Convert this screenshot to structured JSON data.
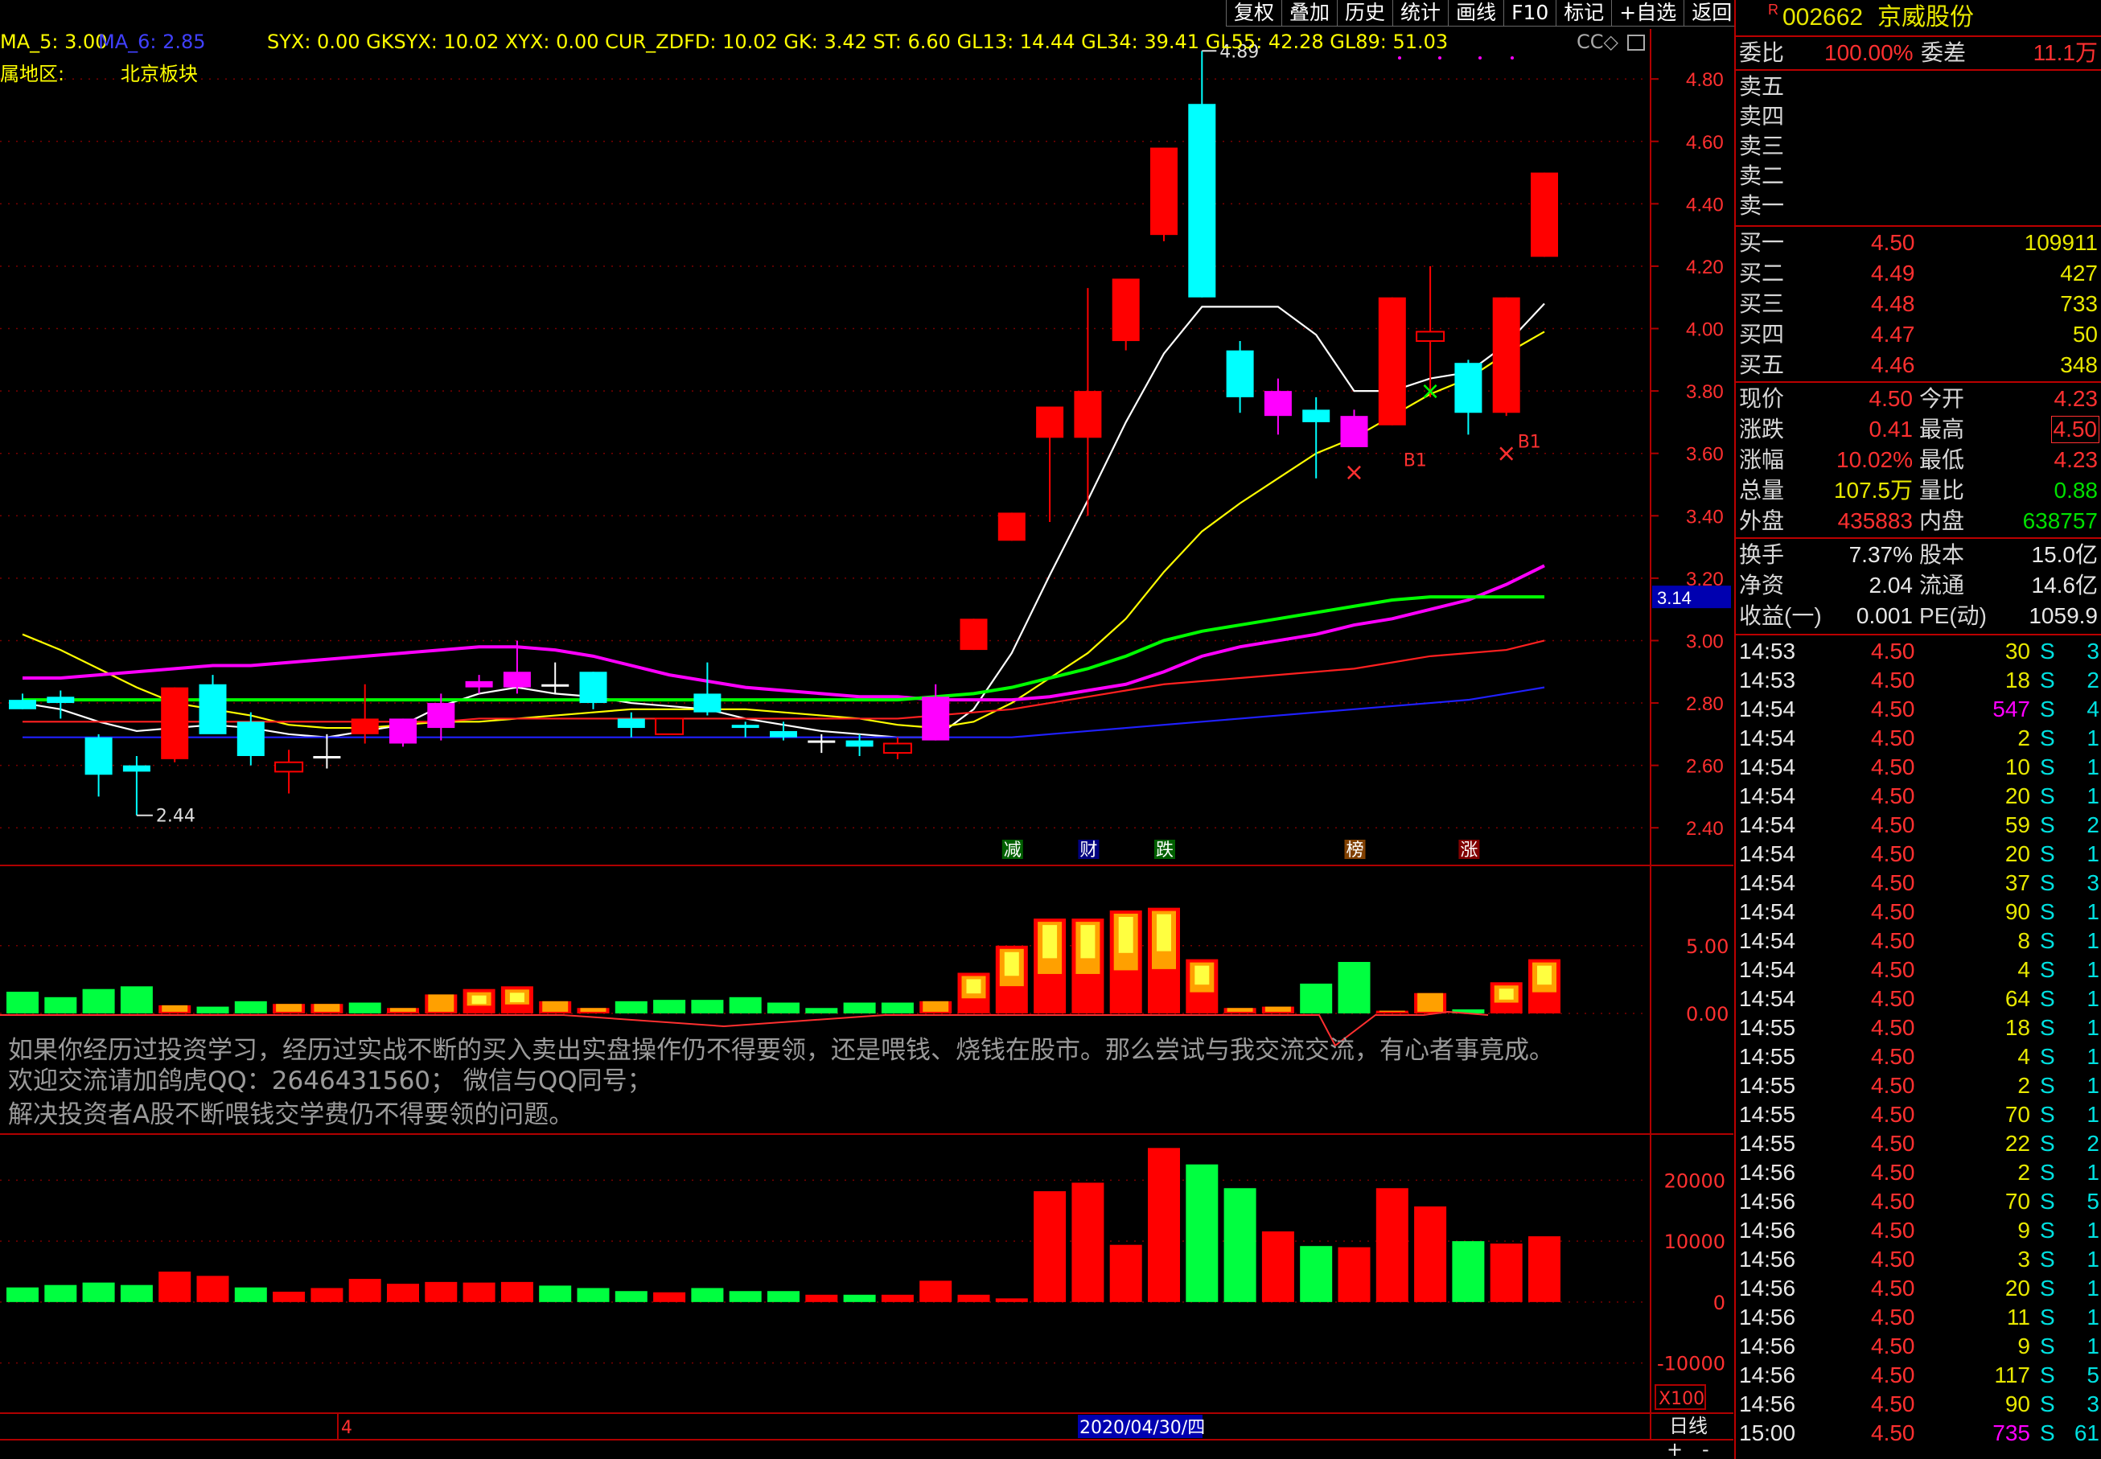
{
  "toolbar": [
    "复权",
    "叠加",
    "历史",
    "统计",
    "画线",
    "F10",
    "标记",
    "+自选",
    "返回"
  ],
  "top_legend": {
    "ma5": "MA_5: 3.00",
    "ma6": "MA_6: 2.85",
    "indicators": "SYX: 0.00  GKSYX: 10.02  XYX: 0.00  CUR_ZDFD: 10.02  GK: 3.42  ST: 6.60  GL13: 14.44  GL34: 39.41  GL55: 42.28  GL89: 51.03",
    "right_marks": "CC◇"
  },
  "region": {
    "label": "属地区:",
    "value": "北京板块"
  },
  "price_labels": {
    "high": "4.89",
    "low": "2.44",
    "current_tag": "3.14"
  },
  "event_tags": [
    "减",
    "财",
    "跌",
    "榜",
    "涨"
  ],
  "signals": {
    "b1a": "B1",
    "b1b": "B1",
    "x_red": "×",
    "x_green": "×"
  },
  "overlay_text": [
    "如果你经历过投资学习，经历过实战不断的买入卖出实盘操作仍不得要领，还是喂钱、烧钱在股市。那么尝试与我交流交流，有心者事竟成。",
    "欢迎交流请加鸽虎QQ：2646431560； 微信与QQ同号；",
    "解决投资者A股不断喂钱交学费仍不得要领的问题。"
  ],
  "x100": "X100",
  "date_bar": {
    "month_tick": "4",
    "date": "2020/04/30/四",
    "period": "日线",
    "plus": "+",
    "minus": "-"
  },
  "chart_data": [
    {
      "type": "candlestick",
      "title": "",
      "ylim": [
        2.3,
        4.95
      ],
      "yticks": [
        2.4,
        2.6,
        2.8,
        3.0,
        3.2,
        3.4,
        3.6,
        3.8,
        4.0,
        4.2,
        4.4,
        4.6,
        4.8
      ],
      "candles": [
        {
          "o": 2.81,
          "h": 2.83,
          "l": 2.78,
          "c": 2.78
        },
        {
          "o": 2.82,
          "h": 2.84,
          "l": 2.75,
          "c": 2.8
        },
        {
          "o": 2.57,
          "h": 2.7,
          "l": 2.5,
          "c": 2.69
        },
        {
          "o": 2.6,
          "h": 2.63,
          "l": 2.44,
          "c": 2.58
        },
        {
          "o": 2.62,
          "h": 2.85,
          "l": 2.61,
          "c": 2.85
        },
        {
          "o": 2.86,
          "h": 2.89,
          "l": 2.71,
          "c": 2.7
        },
        {
          "o": 2.63,
          "h": 2.77,
          "l": 2.6,
          "c": 2.74
        },
        {
          "o": 2.61,
          "h": 2.65,
          "l": 2.51,
          "c": 2.58
        },
        {
          "o": 2.63,
          "h": 2.7,
          "l": 2.59,
          "c": 2.63
        },
        {
          "o": 2.7,
          "h": 2.86,
          "l": 2.67,
          "c": 2.75
        },
        {
          "o": 2.67,
          "h": 2.75,
          "l": 2.66,
          "c": 2.75
        },
        {
          "o": 2.8,
          "h": 2.83,
          "l": 2.68,
          "c": 2.72
        },
        {
          "o": 2.85,
          "h": 2.89,
          "l": 2.83,
          "c": 2.87
        },
        {
          "o": 2.85,
          "h": 3.0,
          "l": 2.83,
          "c": 2.9
        },
        {
          "o": 2.86,
          "h": 2.93,
          "l": 2.83,
          "c": 2.86
        },
        {
          "o": 2.9,
          "h": 2.9,
          "l": 2.78,
          "c": 2.8
        },
        {
          "o": 2.75,
          "h": 2.77,
          "l": 2.69,
          "c": 2.72
        },
        {
          "o": 2.7,
          "h": 2.75,
          "l": 2.7,
          "c": 2.75
        },
        {
          "o": 2.83,
          "h": 2.93,
          "l": 2.76,
          "c": 2.77
        },
        {
          "o": 2.73,
          "h": 2.74,
          "l": 2.69,
          "c": 2.72
        },
        {
          "o": 2.71,
          "h": 2.74,
          "l": 2.68,
          "c": 2.69
        },
        {
          "o": 2.68,
          "h": 2.7,
          "l": 2.64,
          "c": 2.68
        },
        {
          "o": 2.68,
          "h": 2.7,
          "l": 2.63,
          "c": 2.66
        },
        {
          "o": 2.64,
          "h": 2.69,
          "l": 2.62,
          "c": 2.67
        },
        {
          "o": 2.82,
          "h": 2.86,
          "l": 2.68,
          "c": 2.68
        },
        {
          "o": 2.97,
          "h": 3.07,
          "l": 2.97,
          "c": 3.07
        },
        {
          "o": 3.32,
          "h": 3.41,
          "l": 3.32,
          "c": 3.41
        },
        {
          "o": 3.65,
          "h": 3.75,
          "l": 3.38,
          "c": 3.75
        },
        {
          "o": 3.65,
          "h": 4.13,
          "l": 3.4,
          "c": 3.8
        },
        {
          "o": 3.96,
          "h": 4.16,
          "l": 3.93,
          "c": 4.16
        },
        {
          "o": 4.3,
          "h": 4.58,
          "l": 4.28,
          "c": 4.58
        },
        {
          "o": 4.72,
          "h": 4.89,
          "l": 4.1,
          "c": 4.1
        },
        {
          "o": 3.93,
          "h": 3.96,
          "l": 3.73,
          "c": 3.78
        },
        {
          "o": 3.8,
          "h": 3.84,
          "l": 3.66,
          "c": 3.72
        },
        {
          "o": 3.74,
          "h": 3.78,
          "l": 3.52,
          "c": 3.7
        },
        {
          "o": 3.72,
          "h": 3.74,
          "l": 3.62,
          "c": 3.62
        },
        {
          "o": 3.69,
          "h": 4.1,
          "l": 3.69,
          "c": 4.1
        },
        {
          "o": 3.96,
          "h": 4.2,
          "l": 3.78,
          "c": 3.99
        },
        {
          "o": 3.89,
          "h": 3.9,
          "l": 3.66,
          "c": 3.73
        },
        {
          "o": 3.73,
          "h": 4.1,
          "l": 3.72,
          "c": 4.1
        },
        {
          "o": 4.23,
          "h": 4.5,
          "l": 4.23,
          "c": 4.5
        }
      ],
      "candle_colors": [
        "#00ffff",
        "#00ffff",
        "#00ffff",
        "#00ffff",
        "#ff0000",
        "#00ffff",
        "#00ffff",
        "#ff0000",
        "#ffffff",
        "#ff0000",
        "#ff00ff",
        "#ff00ff",
        "#ff00ff",
        "#ff00ff",
        "#ffffff",
        "#00ffff",
        "#00ffff",
        "#ff0000",
        "#00ffff",
        "#00ffff",
        "#00ffff",
        "#ffffff",
        "#00ffff",
        "#ff0000",
        "#ff00ff",
        "#ff0000",
        "#ff0000",
        "#ff0000",
        "#ff0000",
        "#ff0000",
        "#ff0000",
        "#00ffff",
        "#00ffff",
        "#ff00ff",
        "#00ffff",
        "#ff00ff",
        "#ff0000",
        "#ff0000",
        "#00ffff",
        "#ff0000",
        "#ff0000"
      ],
      "candle_hollow": [
        false,
        false,
        false,
        false,
        false,
        false,
        false,
        true,
        false,
        false,
        false,
        false,
        false,
        false,
        false,
        false,
        false,
        true,
        false,
        false,
        false,
        false,
        false,
        true,
        false,
        false,
        false,
        false,
        false,
        false,
        false,
        false,
        false,
        false,
        false,
        false,
        false,
        true,
        false,
        false,
        false
      ],
      "ma_lines": [
        {
          "color": "#ffffff",
          "values": [
            2.8,
            2.78,
            2.74,
            2.71,
            2.72,
            2.73,
            2.72,
            2.7,
            2.69,
            2.71,
            2.73,
            2.79,
            2.83,
            2.85,
            2.83,
            2.82,
            2.8,
            2.79,
            2.78,
            2.75,
            2.73,
            2.71,
            2.7,
            2.69,
            2.69,
            2.78,
            2.96,
            3.21,
            3.45,
            3.7,
            3.92,
            4.07,
            4.07,
            4.07,
            3.98,
            3.8,
            3.8,
            3.84,
            3.86,
            3.95,
            4.08
          ]
        },
        {
          "color": "#ffff00",
          "values": [
            3.02,
            2.97,
            2.91,
            2.85,
            2.8,
            2.78,
            2.76,
            2.73,
            2.72,
            2.72,
            2.73,
            2.74,
            2.74,
            2.75,
            2.76,
            2.77,
            2.78,
            2.78,
            2.78,
            2.78,
            2.77,
            2.76,
            2.75,
            2.73,
            2.72,
            2.74,
            2.8,
            2.88,
            2.96,
            3.07,
            3.22,
            3.35,
            3.44,
            3.52,
            3.6,
            3.65,
            3.72,
            3.79,
            3.84,
            3.92,
            3.99
          ]
        },
        {
          "color": "#ff00ff",
          "values": [
            2.88,
            2.88,
            2.89,
            2.9,
            2.91,
            2.92,
            2.92,
            2.93,
            2.94,
            2.95,
            2.96,
            2.97,
            2.98,
            2.98,
            2.97,
            2.95,
            2.92,
            2.89,
            2.87,
            2.85,
            2.84,
            2.83,
            2.82,
            2.82,
            2.81,
            2.81,
            2.81,
            2.82,
            2.84,
            2.86,
            2.9,
            2.95,
            2.98,
            3.0,
            3.02,
            3.05,
            3.07,
            3.1,
            3.13,
            3.18,
            3.24
          ]
        },
        {
          "color": "#00ff00",
          "values": [
            2.81,
            2.81,
            2.81,
            2.81,
            2.81,
            2.81,
            2.81,
            2.81,
            2.81,
            2.81,
            2.81,
            2.81,
            2.81,
            2.81,
            2.81,
            2.81,
            2.81,
            2.81,
            2.81,
            2.81,
            2.81,
            2.81,
            2.81,
            2.81,
            2.82,
            2.83,
            2.85,
            2.88,
            2.91,
            2.95,
            3.0,
            3.03,
            3.05,
            3.07,
            3.09,
            3.11,
            3.13,
            3.14,
            3.14,
            3.14,
            3.14
          ]
        },
        {
          "color": "#ff2020",
          "values": [
            2.74,
            2.74,
            2.74,
            2.74,
            2.74,
            2.74,
            2.74,
            2.74,
            2.74,
            2.74,
            2.74,
            2.74,
            2.75,
            2.75,
            2.75,
            2.75,
            2.75,
            2.75,
            2.75,
            2.75,
            2.75,
            2.75,
            2.75,
            2.75,
            2.76,
            2.77,
            2.78,
            2.8,
            2.82,
            2.84,
            2.86,
            2.87,
            2.88,
            2.89,
            2.9,
            2.91,
            2.93,
            2.95,
            2.96,
            2.97,
            3.0
          ]
        },
        {
          "color": "#2020ff",
          "values": [
            2.69,
            2.69,
            2.69,
            2.69,
            2.69,
            2.69,
            2.69,
            2.69,
            2.69,
            2.69,
            2.69,
            2.69,
            2.69,
            2.69,
            2.69,
            2.69,
            2.69,
            2.69,
            2.69,
            2.69,
            2.69,
            2.69,
            2.69,
            2.69,
            2.69,
            2.69,
            2.69,
            2.7,
            2.71,
            2.72,
            2.73,
            2.74,
            2.75,
            2.76,
            2.77,
            2.78,
            2.79,
            2.8,
            2.81,
            2.83,
            2.85
          ]
        }
      ]
    },
    {
      "type": "bar",
      "title": "",
      "ylim": [
        -0.5,
        9.5
      ],
      "yticks": [
        0.0,
        5.0
      ],
      "values": [
        1.6,
        1.2,
        1.8,
        2.0,
        0.6,
        0.5,
        0.9,
        0.7,
        0.7,
        0.8,
        0.4,
        1.4,
        1.8,
        2.0,
        0.9,
        0.4,
        0.9,
        1.0,
        1.0,
        1.2,
        0.8,
        0.4,
        0.8,
        0.8,
        0.9,
        3.0,
        5.0,
        7.0,
        7.0,
        7.6,
        7.8,
        4.0,
        0.4,
        0.5,
        2.2,
        3.8,
        0.2,
        1.5,
        0.3,
        2.3,
        4.0
      ],
      "types": [
        "g",
        "g",
        "g",
        "g",
        "o",
        "g",
        "g",
        "o",
        "o",
        "g",
        "o",
        "o",
        "o",
        "o",
        "o",
        "o",
        "g",
        "g",
        "g",
        "g",
        "g",
        "g",
        "g",
        "g",
        "o",
        "o",
        "o",
        "o",
        "o",
        "o",
        "o",
        "o",
        "o",
        "o",
        "g",
        "g",
        "o",
        "o",
        "g",
        "o",
        "o"
      ]
    },
    {
      "type": "bar",
      "title": "",
      "ylim": [
        -16000,
        26000
      ],
      "yticks": [
        20000,
        10000,
        0,
        -10000
      ],
      "values": [
        2400,
        2800,
        3200,
        2800,
        5000,
        4300,
        2400,
        1700,
        2300,
        3800,
        3000,
        3300,
        3200,
        3300,
        2700,
        2300,
        1800,
        1600,
        2300,
        1800,
        1800,
        1200,
        1200,
        1200,
        3500,
        1200,
        600,
        18200,
        19600,
        9400,
        25300,
        22600,
        18700,
        11600,
        9200,
        9000,
        18700,
        15700,
        10000,
        9600,
        10800
      ],
      "colors": [
        "g",
        "g",
        "g",
        "g",
        "r",
        "r",
        "g",
        "r",
        "r",
        "r",
        "r",
        "r",
        "r",
        "r",
        "g",
        "g",
        "g",
        "r",
        "g",
        "g",
        "g",
        "r",
        "g",
        "r",
        "r",
        "r",
        "r",
        "r",
        "r",
        "r",
        "r",
        "g",
        "g",
        "r",
        "g",
        "r",
        "r",
        "r",
        "g",
        "r",
        "r"
      ]
    }
  ],
  "side": {
    "code": "002662",
    "name": "京威股份",
    "weibi": {
      "label": "委比",
      "value": "100.00%",
      "label2": "委差",
      "value2": "11.1万"
    },
    "sells": [
      {
        "label": "卖五",
        "price": "",
        "vol": ""
      },
      {
        "label": "卖四",
        "price": "",
        "vol": ""
      },
      {
        "label": "卖三",
        "price": "",
        "vol": ""
      },
      {
        "label": "卖二",
        "price": "",
        "vol": ""
      },
      {
        "label": "卖一",
        "price": "",
        "vol": ""
      }
    ],
    "buys": [
      {
        "label": "买一",
        "price": "4.50",
        "vol": "109911"
      },
      {
        "label": "买二",
        "price": "4.49",
        "vol": "427"
      },
      {
        "label": "买三",
        "price": "4.48",
        "vol": "733"
      },
      {
        "label": "买四",
        "price": "4.47",
        "vol": "50"
      },
      {
        "label": "买五",
        "price": "4.46",
        "vol": "348"
      }
    ],
    "stats1": [
      {
        "l1": "现价",
        "v1": "4.50",
        "c1": "red",
        "l2": "今开",
        "v2": "4.23",
        "c2": "red"
      },
      {
        "l1": "涨跌",
        "v1": "0.41",
        "c1": "red",
        "l2": "最高",
        "v2": "4.50",
        "c2": "red"
      },
      {
        "l1": "涨幅",
        "v1": "10.02%",
        "c1": "red",
        "l2": "最低",
        "v2": "4.23",
        "c2": "red"
      },
      {
        "l1": "总量",
        "v1": "107.5万",
        "c1": "yel",
        "l2": "量比",
        "v2": "0.88",
        "c2": "grn"
      },
      {
        "l1": "外盘",
        "v1": "435883",
        "c1": "red",
        "l2": "内盘",
        "v2": "638757",
        "c2": "grn"
      }
    ],
    "stats2": [
      {
        "l1": "换手",
        "v1": "7.37%",
        "l2": "股本",
        "v2": "15.0亿"
      },
      {
        "l1": "净资",
        "v1": "2.04",
        "l2": "流通",
        "v2": "14.6亿"
      },
      {
        "l1": "收益(一)",
        "v1": "0.001",
        "l2": "PE(动)",
        "v2": "1059.9"
      }
    ],
    "ticks": [
      {
        "t": "14:53",
        "p": "4.50",
        "v": "30",
        "s": "S",
        "n": "3"
      },
      {
        "t": "14:53",
        "p": "4.50",
        "v": "18",
        "s": "S",
        "n": "2"
      },
      {
        "t": "14:54",
        "p": "4.50",
        "v": "547",
        "s": "S",
        "n": "4"
      },
      {
        "t": "14:54",
        "p": "4.50",
        "v": "2",
        "s": "S",
        "n": "1"
      },
      {
        "t": "14:54",
        "p": "4.50",
        "v": "10",
        "s": "S",
        "n": "1"
      },
      {
        "t": "14:54",
        "p": "4.50",
        "v": "20",
        "s": "S",
        "n": "1"
      },
      {
        "t": "14:54",
        "p": "4.50",
        "v": "59",
        "s": "S",
        "n": "2"
      },
      {
        "t": "14:54",
        "p": "4.50",
        "v": "20",
        "s": "S",
        "n": "1"
      },
      {
        "t": "14:54",
        "p": "4.50",
        "v": "37",
        "s": "S",
        "n": "3"
      },
      {
        "t": "14:54",
        "p": "4.50",
        "v": "90",
        "s": "S",
        "n": "1"
      },
      {
        "t": "14:54",
        "p": "4.50",
        "v": "8",
        "s": "S",
        "n": "1"
      },
      {
        "t": "14:54",
        "p": "4.50",
        "v": "4",
        "s": "S",
        "n": "1"
      },
      {
        "t": "14:54",
        "p": "4.50",
        "v": "64",
        "s": "S",
        "n": "1"
      },
      {
        "t": "14:55",
        "p": "4.50",
        "v": "18",
        "s": "S",
        "n": "1"
      },
      {
        "t": "14:55",
        "p": "4.50",
        "v": "4",
        "s": "S",
        "n": "1"
      },
      {
        "t": "14:55",
        "p": "4.50",
        "v": "2",
        "s": "S",
        "n": "1"
      },
      {
        "t": "14:55",
        "p": "4.50",
        "v": "70",
        "s": "S",
        "n": "1"
      },
      {
        "t": "14:55",
        "p": "4.50",
        "v": "22",
        "s": "S",
        "n": "2"
      },
      {
        "t": "14:56",
        "p": "4.50",
        "v": "2",
        "s": "S",
        "n": "1"
      },
      {
        "t": "14:56",
        "p": "4.50",
        "v": "70",
        "s": "S",
        "n": "5"
      },
      {
        "t": "14:56",
        "p": "4.50",
        "v": "9",
        "s": "S",
        "n": "1"
      },
      {
        "t": "14:56",
        "p": "4.50",
        "v": "3",
        "s": "S",
        "n": "1"
      },
      {
        "t": "14:56",
        "p": "4.50",
        "v": "20",
        "s": "S",
        "n": "1"
      },
      {
        "t": "14:56",
        "p": "4.50",
        "v": "11",
        "s": "S",
        "n": "1"
      },
      {
        "t": "14:56",
        "p": "4.50",
        "v": "9",
        "s": "S",
        "n": "1"
      },
      {
        "t": "14:56",
        "p": "4.50",
        "v": "117",
        "s": "S",
        "n": "5"
      },
      {
        "t": "14:56",
        "p": "4.50",
        "v": "90",
        "s": "S",
        "n": "3"
      },
      {
        "t": "15:00",
        "p": "4.50",
        "v": "735",
        "s": "S",
        "n": "61"
      }
    ]
  }
}
